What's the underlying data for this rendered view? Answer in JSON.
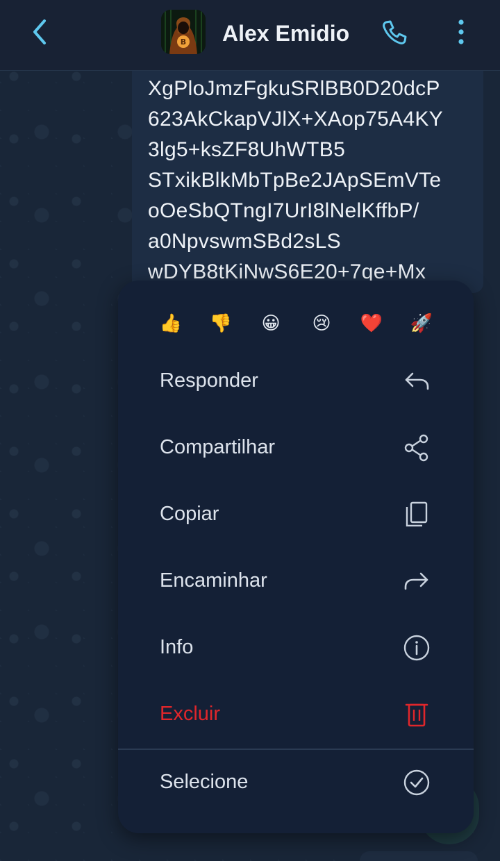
{
  "header": {
    "title": "Alex Emidio"
  },
  "message": {
    "lines": [
      "XgPloJmzFgkuSRlBB0D20dcP",
      "623AkCkapVJlX+XAop75A4KY",
      "3lg5+ksZF8UhWTB5",
      "STxikBlkMbTpBe2JApSEmVTe",
      "oOeSbQTngI7UrI8lNelKffbP/",
      "a0NpvswmSBd2sLS",
      "wDYB8tKiNwS6E20+7qe+Mx"
    ]
  },
  "reactions": [
    "👍",
    "👎",
    "😀",
    "😢",
    "❤️",
    "🚀"
  ],
  "menu": {
    "items": [
      {
        "label": "Responder",
        "icon": "reply-icon"
      },
      {
        "label": "Compartilhar",
        "icon": "share-icon"
      },
      {
        "label": "Copiar",
        "icon": "copy-icon"
      },
      {
        "label": "Encaminhar",
        "icon": "forward-icon"
      },
      {
        "label": "Info",
        "icon": "info-icon"
      },
      {
        "label": "Excluir",
        "icon": "trash-icon",
        "danger": true
      },
      {
        "label": "Selecione",
        "icon": "check-circle-icon"
      }
    ]
  },
  "colors": {
    "accent": "#5ec8ee",
    "danger": "#e0262b",
    "menu_bg": "#142036",
    "header_bg": "#182234"
  }
}
